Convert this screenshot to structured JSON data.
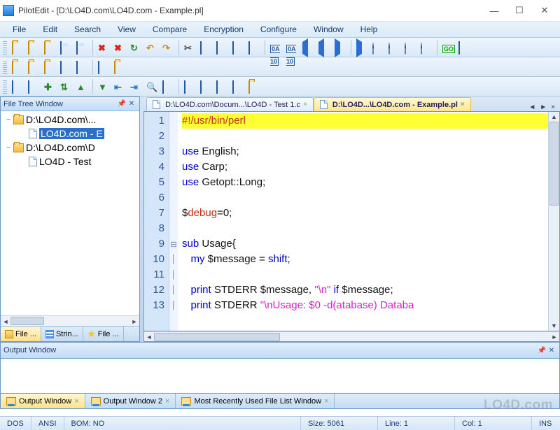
{
  "app": {
    "icon": "pilotedit-icon",
    "title": "PilotEdit - [D:\\LO4D.com\\LO4D.com - Example.pl]"
  },
  "win": {
    "min": "—",
    "max": "☐",
    "close": "✕"
  },
  "menu": [
    "File",
    "Edit",
    "Search",
    "View",
    "Compare",
    "Encryption",
    "Configure",
    "Window",
    "Help"
  ],
  "toolbar1_names": [
    "new-folder",
    "open-folder",
    "open-folder-blue",
    "save",
    "save-all",
    "delete",
    "delete-all",
    "refresh",
    "undo",
    "redo",
    "cut",
    "copy",
    "paste",
    "paste-special",
    "select-all",
    "hex-view",
    "numeric-view",
    "prev",
    "prev-fast",
    "next",
    "next-fast",
    "find-users-1",
    "find-users-2",
    "find-users-3",
    "find-users-4",
    "goto",
    "help"
  ],
  "toolbar2_names": [
    "folder-a",
    "folder-b",
    "folder-c",
    "square-a",
    "square-b",
    "square-c",
    "folder-arrow"
  ],
  "toolbar3_names": [
    "copy-up",
    "copy-down",
    "plus-green",
    "sync",
    "up-green",
    "down-green",
    "indent-out",
    "indent-in",
    "find",
    "bookmark",
    "move-v",
    "add-box-a",
    "add-box-b",
    "add-box-c",
    "expand"
  ],
  "filetree": {
    "title": "File Tree Window",
    "pin": "📌",
    "close": "✕",
    "nodes": [
      {
        "toggle": "−",
        "indent": 0,
        "type": "folder",
        "label": "D:\\LO4D.com\\...",
        "selected": false
      },
      {
        "toggle": "",
        "indent": 1,
        "type": "doc",
        "label": "LO4D.com - E",
        "selected": true
      },
      {
        "toggle": "−",
        "indent": 0,
        "type": "folder",
        "label": "D:\\LO4D.com\\D",
        "selected": false
      },
      {
        "toggle": "",
        "indent": 1,
        "type": "doc",
        "label": "LO4D - Test",
        "selected": false
      }
    ],
    "scroll": {
      "left": "◄",
      "right": "►"
    },
    "tabs": [
      {
        "icon": "ico-folder",
        "label": "File ...",
        "selected": true
      },
      {
        "icon": "ico-list",
        "label": "Strin...",
        "selected": false
      },
      {
        "icon": "ico-star",
        "label": "File ...",
        "selected": false
      }
    ]
  },
  "doctabs": {
    "items": [
      {
        "icon": "doc",
        "label": "D:\\LO4D.com\\Docum...\\LO4D - Test 1.c",
        "active": false
      },
      {
        "icon": "doc",
        "label": "D:\\LO4D...\\LO4D.com - Example.pl",
        "active": true
      }
    ],
    "nav_prev": "◄",
    "nav_next": "►",
    "close": "×"
  },
  "code": {
    "lines": [
      {
        "n": "1",
        "hl": true,
        "fold": "",
        "spans": [
          {
            "c": "var",
            "t": "#!/usr/bin/perl"
          }
        ]
      },
      {
        "n": "2",
        "hl": false,
        "fold": "",
        "spans": []
      },
      {
        "n": "3",
        "hl": false,
        "fold": "",
        "spans": [
          {
            "c": "kw",
            "t": "use"
          },
          {
            "c": "plain",
            "t": " English;"
          }
        ]
      },
      {
        "n": "4",
        "hl": false,
        "fold": "",
        "spans": [
          {
            "c": "kw",
            "t": "use"
          },
          {
            "c": "plain",
            "t": " Carp;"
          }
        ]
      },
      {
        "n": "5",
        "hl": false,
        "fold": "",
        "spans": [
          {
            "c": "kw",
            "t": "use"
          },
          {
            "c": "plain",
            "t": " Getopt::Long;"
          }
        ]
      },
      {
        "n": "6",
        "hl": false,
        "fold": "",
        "spans": []
      },
      {
        "n": "7",
        "hl": false,
        "fold": "",
        "spans": [
          {
            "c": "plain",
            "t": "$"
          },
          {
            "c": "var",
            "t": "debug"
          },
          {
            "c": "plain",
            "t": "=0;"
          }
        ]
      },
      {
        "n": "8",
        "hl": false,
        "fold": "",
        "spans": []
      },
      {
        "n": "9",
        "hl": false,
        "fold": "⊟",
        "spans": [
          {
            "c": "kw",
            "t": "sub"
          },
          {
            "c": "plain",
            "t": " Usage{"
          }
        ]
      },
      {
        "n": "10",
        "hl": false,
        "fold": "│",
        "spans": [
          {
            "c": "plain",
            "t": "   "
          },
          {
            "c": "kw",
            "t": "my"
          },
          {
            "c": "plain",
            "t": " $message = "
          },
          {
            "c": "kw",
            "t": "shift"
          },
          {
            "c": "plain",
            "t": ";"
          }
        ]
      },
      {
        "n": "11",
        "hl": false,
        "fold": "│",
        "spans": []
      },
      {
        "n": "12",
        "hl": false,
        "fold": "│",
        "spans": [
          {
            "c": "plain",
            "t": "   "
          },
          {
            "c": "kw",
            "t": "print"
          },
          {
            "c": "plain",
            "t": " STDERR $message, "
          },
          {
            "c": "str",
            "t": "\"\\n\""
          },
          {
            "c": "plain",
            "t": " "
          },
          {
            "c": "kw",
            "t": "if"
          },
          {
            "c": "plain",
            "t": " $message;"
          }
        ]
      },
      {
        "n": "13",
        "hl": false,
        "fold": "│",
        "spans": [
          {
            "c": "plain",
            "t": "   "
          },
          {
            "c": "kw",
            "t": "print"
          },
          {
            "c": "plain",
            "t": " STDERR "
          },
          {
            "c": "str",
            "t": "\"\\nUsage: $0 -d(atabase) Databa"
          }
        ]
      }
    ],
    "hscroll": {
      "left": "◄",
      "right": "►"
    },
    "vscroll": {
      "up": "▲",
      "down": "▼"
    }
  },
  "output": {
    "title": "Output Window",
    "pin": "📌",
    "close": "✕",
    "tabs": [
      {
        "label": "Output Window",
        "selected": true
      },
      {
        "label": "Output Window 2",
        "selected": false
      },
      {
        "label": "Most Recently Used File List Window",
        "selected": false
      }
    ]
  },
  "status": {
    "enc1": "DOS",
    "enc2": "ANSI",
    "bom": "BOM: NO",
    "size": "Size: 5061",
    "line": "Line: 1",
    "col": "Col: 1",
    "ins": "INS"
  },
  "watermark": "LO4D.com"
}
